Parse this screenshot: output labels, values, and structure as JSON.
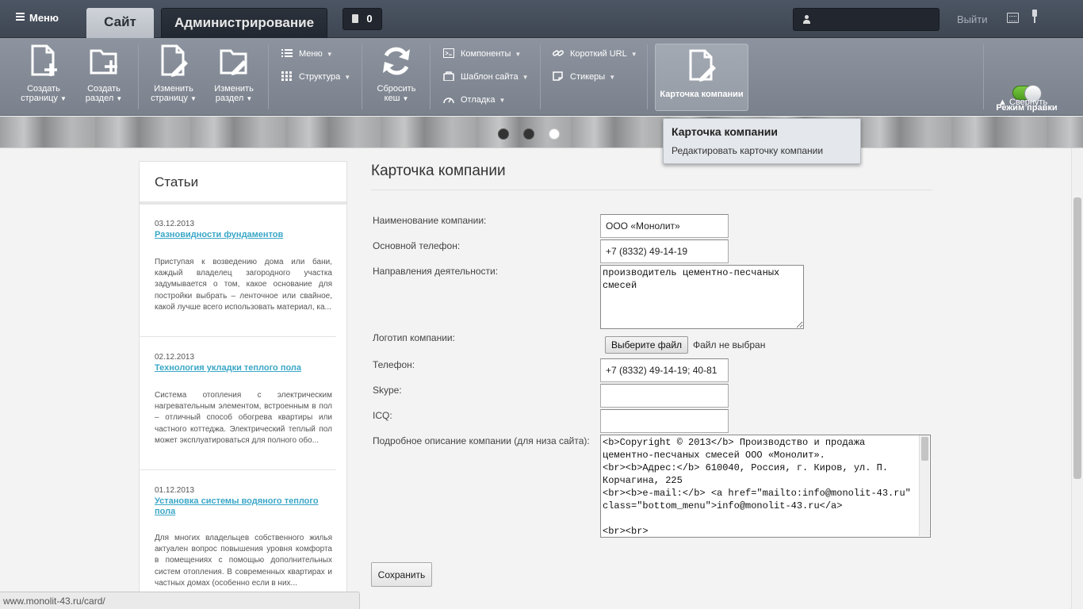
{
  "topbar": {
    "menu_label": "Меню",
    "tabs": [
      {
        "label": "Сайт",
        "active": true
      },
      {
        "label": "Администрирование",
        "active": false
      }
    ],
    "notifications_count": "0",
    "user_name": "",
    "logout_label": "Выйти"
  },
  "toolbar": {
    "create_page": "Создать страницу",
    "create_section": "Создать раздел",
    "edit_page": "Изменить страницу",
    "edit_section": "Изменить раздел",
    "menu": "Меню",
    "structure": "Структура",
    "reset_cache": "Сбросить кеш",
    "components": "Компоненты",
    "site_template": "Шаблон сайта",
    "debug": "Отладка",
    "short_url": "Короткий URL",
    "stickers": "Стикеры",
    "company_card": "Карточка компании",
    "edit_mode_label": "Режим правки включен",
    "edit_mode_on": true,
    "collapse_label": "Свернуть"
  },
  "popup": {
    "title": "Карточка компании",
    "item": "Редактировать карточку компании"
  },
  "sidebar": {
    "title": "Статьи",
    "articles": [
      {
        "date": "03.12.2013",
        "title": "Разновидности фундаментов",
        "excerpt": "Приступая к возведению дома или бани, каждый владелец загородного участка задумывается о том, какое основание для постройки выбрать – ленточное или свайное, какой лучше всего использовать материал, ка..."
      },
      {
        "date": "02.12.2013",
        "title": "Технология укладки теплого пола",
        "excerpt": "Система отопления с электрическим нагревательным элементом, встроенным в пол – отличный способ обогрева квартиры или частного коттеджа. Электрический теплый пол может эксплуатироваться для полного обо..."
      },
      {
        "date": "01.12.2013",
        "title": "Установка системы водяного теплого пола",
        "excerpt": "Для многих владельцев собственного жилья актуален вопрос повышения уровня комфорта в помещениях с помощью дополнительных систем отопления. В современных квартирах и частных домах (особенно если в них..."
      }
    ]
  },
  "form": {
    "title": "Карточка компании",
    "fields": {
      "company_name": {
        "label": "Наименование компании:",
        "value": "ООО «Монолит»"
      },
      "main_phone": {
        "label": "Основной телефон:",
        "value": "+7 (8332) 49-14-19"
      },
      "activity": {
        "label": "Направления деятельности:",
        "value": "производитель цементно-песчаных смесей"
      },
      "logo": {
        "label": "Логотип компании:",
        "button": "Выберите файл",
        "status": "Файл не выбран"
      },
      "phone": {
        "label": "Телефон:",
        "value": "+7 (8332) 49-14-19; 40-81"
      },
      "skype": {
        "label": "Skype:",
        "value": ""
      },
      "icq": {
        "label": "ICQ:",
        "value": ""
      },
      "description": {
        "label": "Подробное описание компании (для низа сайта):",
        "value": "<b>Copyright © 2013</b> Производство и продажа цементно-песчаных смесей ООО «Монолит».\n<br><b>Адрес:</b> 610040, Россия, г. Киров, ул. П. Корчагина, 225\n<br><b>e-mail:</b> <a href=\"mailto:info@monolit-43.ru\" class=\"bottom_menu\">info@monolit-43.ru</a>\n\n<br><br>"
      }
    },
    "save_label": "Сохранить"
  },
  "statusbar": {
    "url": "www.monolit-43.ru/card/"
  },
  "colors": {
    "link": "#3aa7c7",
    "toolbar": "#8d949f",
    "topbar": "#4c5563",
    "toggle_on": "#7ac943"
  }
}
